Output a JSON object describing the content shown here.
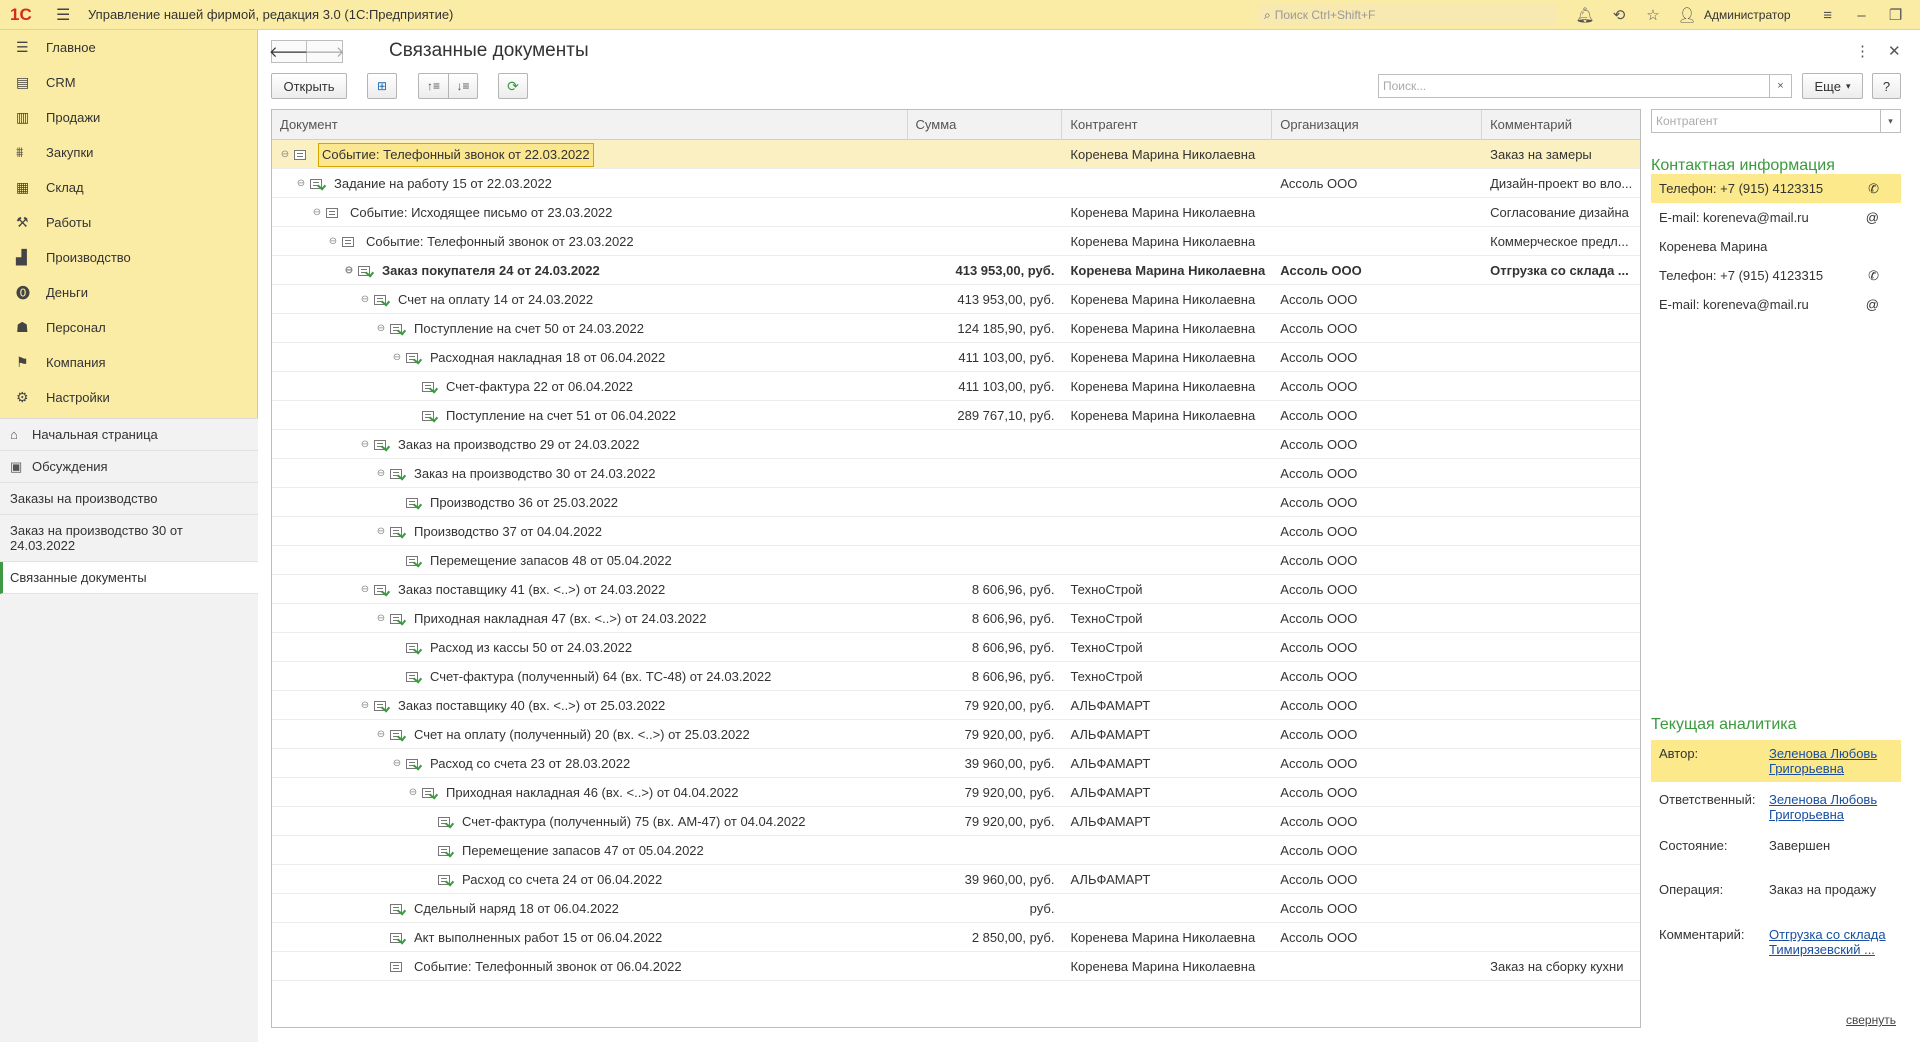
{
  "app": {
    "logo": "1С",
    "title": "Управление нашей фирмой, редакция 3.0  (1С:Предприятие)",
    "search_placeholder": "Поиск Ctrl+Shift+F",
    "user": "Администратор"
  },
  "nav": [
    {
      "label": "Главное",
      "icon": "menu-list-icon"
    },
    {
      "label": "CRM",
      "icon": "crm-icon"
    },
    {
      "label": "Продажи",
      "icon": "sales-icon"
    },
    {
      "label": "Закупки",
      "icon": "purchases-icon"
    },
    {
      "label": "Склад",
      "icon": "warehouse-icon"
    },
    {
      "label": "Работы",
      "icon": "works-icon"
    },
    {
      "label": "Производство",
      "icon": "production-icon"
    },
    {
      "label": "Деньги",
      "icon": "money-icon"
    },
    {
      "label": "Персонал",
      "icon": "personnel-icon"
    },
    {
      "label": "Компания",
      "icon": "company-icon"
    },
    {
      "label": "Настройки",
      "icon": "settings-icon"
    }
  ],
  "open_windows": [
    {
      "label": "Начальная страница",
      "icon": "home-icon"
    },
    {
      "label": "Обсуждения",
      "icon": "discussions-icon"
    },
    {
      "label": "Заказы на производство",
      "icon": ""
    },
    {
      "label": "Заказ на производство 30 от 24.03.2022",
      "icon": ""
    },
    {
      "label": "Связанные документы",
      "icon": ""
    }
  ],
  "page": {
    "title": "Связанные документы",
    "back": "🡐",
    "forward": "🡒",
    "more": "⋮",
    "close": "✕"
  },
  "toolbar": {
    "open_label": "Открыть",
    "search_placeholder": "Поиск...",
    "clear": "×",
    "more_label": "Еще",
    "help_label": "?"
  },
  "columns": {
    "doc": "Документ",
    "sum": "Сумма",
    "kontr": "Контрагент",
    "org": "Организация",
    "com": "Комментарий"
  },
  "rows": [
    {
      "level": 0,
      "toggle": true,
      "posted": false,
      "doc": "Событие: Телефонный звонок от 22.03.2022",
      "sum": "",
      "kontr": "Коренева Марина Николаевна",
      "org": "",
      "com": "Заказ на замеры",
      "selected": true
    },
    {
      "level": 1,
      "toggle": true,
      "posted": true,
      "doc": "Задание на работу 15 от 22.03.2022",
      "sum": "",
      "kontr": "",
      "org": "Ассоль ООО",
      "com": "Дизайн-проект во вло..."
    },
    {
      "level": 2,
      "toggle": true,
      "posted": false,
      "doc": "Событие: Исходящее письмо от 23.03.2022",
      "sum": "",
      "kontr": "Коренева Марина Николаевна",
      "org": "",
      "com": "Согласование дизайна"
    },
    {
      "level": 3,
      "toggle": true,
      "posted": false,
      "doc": "Событие: Телефонный звонок от 23.03.2022",
      "sum": "",
      "kontr": "Коренева Марина Николаевна",
      "org": "",
      "com": "Коммерческое предл..."
    },
    {
      "level": 4,
      "toggle": true,
      "posted": true,
      "doc": "Заказ покупателя 24 от 24.03.2022",
      "sum": "413 953,00, руб.",
      "kontr": "Коренева Марина Николаевна",
      "org": "Ассоль ООО",
      "com": "Отгрузка со склада ...",
      "bold": true
    },
    {
      "level": 5,
      "toggle": true,
      "posted": true,
      "doc": "Счет на оплату 14 от 24.03.2022",
      "sum": "413 953,00, руб.",
      "kontr": "Коренева Марина Николаевна",
      "org": "Ассоль ООО",
      "com": ""
    },
    {
      "level": 6,
      "toggle": true,
      "posted": true,
      "doc": "Поступление на счет 50 от 24.03.2022",
      "sum": "124 185,90, руб.",
      "kontr": "Коренева Марина Николаевна",
      "org": "Ассоль ООО",
      "com": ""
    },
    {
      "level": 7,
      "toggle": true,
      "posted": true,
      "doc": "Расходная накладная 18 от 06.04.2022",
      "sum": "411 103,00, руб.",
      "kontr": "Коренева Марина Николаевна",
      "org": "Ассоль ООО",
      "com": ""
    },
    {
      "level": 8,
      "toggle": false,
      "posted": true,
      "doc": "Счет-фактура 22 от 06.04.2022",
      "sum": "411 103,00, руб.",
      "kontr": "Коренева Марина Николаевна",
      "org": "Ассоль ООО",
      "com": ""
    },
    {
      "level": 8,
      "toggle": false,
      "posted": true,
      "doc": "Поступление на счет 51 от 06.04.2022",
      "sum": "289 767,10, руб.",
      "kontr": "Коренева Марина Николаевна",
      "org": "Ассоль ООО",
      "com": ""
    },
    {
      "level": 5,
      "toggle": true,
      "posted": true,
      "doc": "Заказ на производство 29 от 24.03.2022",
      "sum": "",
      "kontr": "",
      "org": "Ассоль ООО",
      "com": ""
    },
    {
      "level": 6,
      "toggle": true,
      "posted": true,
      "doc": "Заказ на производство 30 от 24.03.2022",
      "sum": "",
      "kontr": "",
      "org": "Ассоль ООО",
      "com": ""
    },
    {
      "level": 7,
      "toggle": false,
      "posted": true,
      "doc": "Производство 36 от 25.03.2022",
      "sum": "",
      "kontr": "",
      "org": "Ассоль ООО",
      "com": ""
    },
    {
      "level": 6,
      "toggle": true,
      "posted": true,
      "doc": "Производство 37 от 04.04.2022",
      "sum": "",
      "kontr": "",
      "org": "Ассоль ООО",
      "com": ""
    },
    {
      "level": 7,
      "toggle": false,
      "posted": true,
      "doc": "Перемещение запасов 48 от 05.04.2022",
      "sum": "",
      "kontr": "",
      "org": "Ассоль ООО",
      "com": ""
    },
    {
      "level": 5,
      "toggle": true,
      "posted": true,
      "doc": "Заказ поставщику 41 (вх. <..>) от 24.03.2022",
      "sum": "8 606,96, руб.",
      "kontr": "ТехноСтрой",
      "org": "Ассоль ООО",
      "com": ""
    },
    {
      "level": 6,
      "toggle": true,
      "posted": true,
      "doc": "Приходная накладная 47 (вх. <..>) от 24.03.2022",
      "sum": "8 606,96, руб.",
      "kontr": "ТехноСтрой",
      "org": "Ассоль ООО",
      "com": ""
    },
    {
      "level": 7,
      "toggle": false,
      "posted": true,
      "doc": "Расход из кассы 50 от 24.03.2022",
      "sum": "8 606,96, руб.",
      "kontr": "ТехноСтрой",
      "org": "Ассоль ООО",
      "com": ""
    },
    {
      "level": 7,
      "toggle": false,
      "posted": true,
      "doc": "Счет-фактура (полученный) 64 (вх. ТС-48) от 24.03.2022",
      "sum": "8 606,96, руб.",
      "kontr": "ТехноСтрой",
      "org": "Ассоль ООО",
      "com": ""
    },
    {
      "level": 5,
      "toggle": true,
      "posted": true,
      "doc": "Заказ поставщику 40 (вх. <..>) от 25.03.2022",
      "sum": "79 920,00, руб.",
      "kontr": "АЛЬФАМАРТ",
      "org": "Ассоль ООО",
      "com": ""
    },
    {
      "level": 6,
      "toggle": true,
      "posted": true,
      "doc": "Счет на оплату (полученный) 20 (вх. <..>) от 25.03.2022",
      "sum": "79 920,00, руб.",
      "kontr": "АЛЬФАМАРТ",
      "org": "Ассоль ООО",
      "com": ""
    },
    {
      "level": 7,
      "toggle": true,
      "posted": true,
      "doc": "Расход со счета 23 от 28.03.2022",
      "sum": "39 960,00, руб.",
      "kontr": "АЛЬФАМАРТ",
      "org": "Ассоль ООО",
      "com": ""
    },
    {
      "level": 8,
      "toggle": true,
      "posted": true,
      "doc": "Приходная накладная 46 (вх. <..>) от 04.04.2022",
      "sum": "79 920,00, руб.",
      "kontr": "АЛЬФАМАРТ",
      "org": "Ассоль ООО",
      "com": ""
    },
    {
      "level": 9,
      "toggle": false,
      "posted": true,
      "doc": "Счет-фактура (полученный) 75 (вх. АМ-47) от 04.04.2022",
      "sum": "79 920,00, руб.",
      "kontr": "АЛЬФАМАРТ",
      "org": "Ассоль ООО",
      "com": ""
    },
    {
      "level": 9,
      "toggle": false,
      "posted": true,
      "doc": "Перемещение запасов 47 от 05.04.2022",
      "sum": "",
      "kontr": "",
      "org": "Ассоль ООО",
      "com": ""
    },
    {
      "level": 9,
      "toggle": false,
      "posted": true,
      "doc": "Расход со счета 24 от 06.04.2022",
      "sum": "39 960,00, руб.",
      "kontr": "АЛЬФАМАРТ",
      "org": "Ассоль ООО",
      "com": ""
    },
    {
      "level": 6,
      "toggle": false,
      "posted": true,
      "doc": "Сдельный наряд 18 от 06.04.2022",
      "sum": "руб.",
      "kontr": "",
      "org": "Ассоль ООО",
      "com": ""
    },
    {
      "level": 6,
      "toggle": false,
      "posted": true,
      "doc": "Акт выполненных работ 15 от 06.04.2022",
      "sum": "2 850,00, руб.",
      "kontr": "Коренева Марина Николаевна",
      "org": "Ассоль ООО",
      "com": ""
    },
    {
      "level": 6,
      "toggle": false,
      "posted": false,
      "doc": "Событие: Телефонный звонок от 06.04.2022",
      "sum": "",
      "kontr": "Коренева Марина Николаевна",
      "org": "",
      "com": "Заказ на сборку кухни"
    }
  ],
  "right_panel": {
    "kontr_placeholder": "Контрагент",
    "contact_title": "Контактная информация",
    "contacts": [
      {
        "text": "Телефон: +7 (915) 4123315",
        "icon": "✆",
        "hl": true
      },
      {
        "text": "E-mail: koreneva@mail.ru",
        "icon": "@",
        "hl": false
      },
      {
        "text": "Коренева Марина",
        "icon": "",
        "hl": false
      },
      {
        "text": "Телефон: +7 (915) 4123315",
        "icon": "✆",
        "hl": false
      },
      {
        "text": "E-mail: koreneva@mail.ru",
        "icon": "@",
        "hl": false
      }
    ],
    "analytics_title": "Текущая аналитика",
    "analytics": [
      {
        "label": "Автор:",
        "value": "Зеленова Любовь Григорьевна",
        "link": true,
        "hl": true
      },
      {
        "label": "Ответственный:",
        "value": "Зеленова Любовь Григорьевна",
        "link": true,
        "hl": false
      },
      {
        "label": "Состояние:",
        "value": "Завершен",
        "link": false,
        "hl": false
      },
      {
        "label": "Операция:",
        "value": "Заказ на продажу",
        "link": false,
        "hl": false
      },
      {
        "label": "Комментарий:",
        "value": "Отгрузка со склада Тимирязевский ...",
        "link": true,
        "hl": false
      }
    ],
    "collapse_label": "свернуть"
  },
  "colors": {
    "accent_yellow": "#fbeca5",
    "selection": "#fbf0c1",
    "brand_green": "#3b9a3e",
    "logo_red": "#d52b1e",
    "link_blue": "#1a4fa0"
  }
}
